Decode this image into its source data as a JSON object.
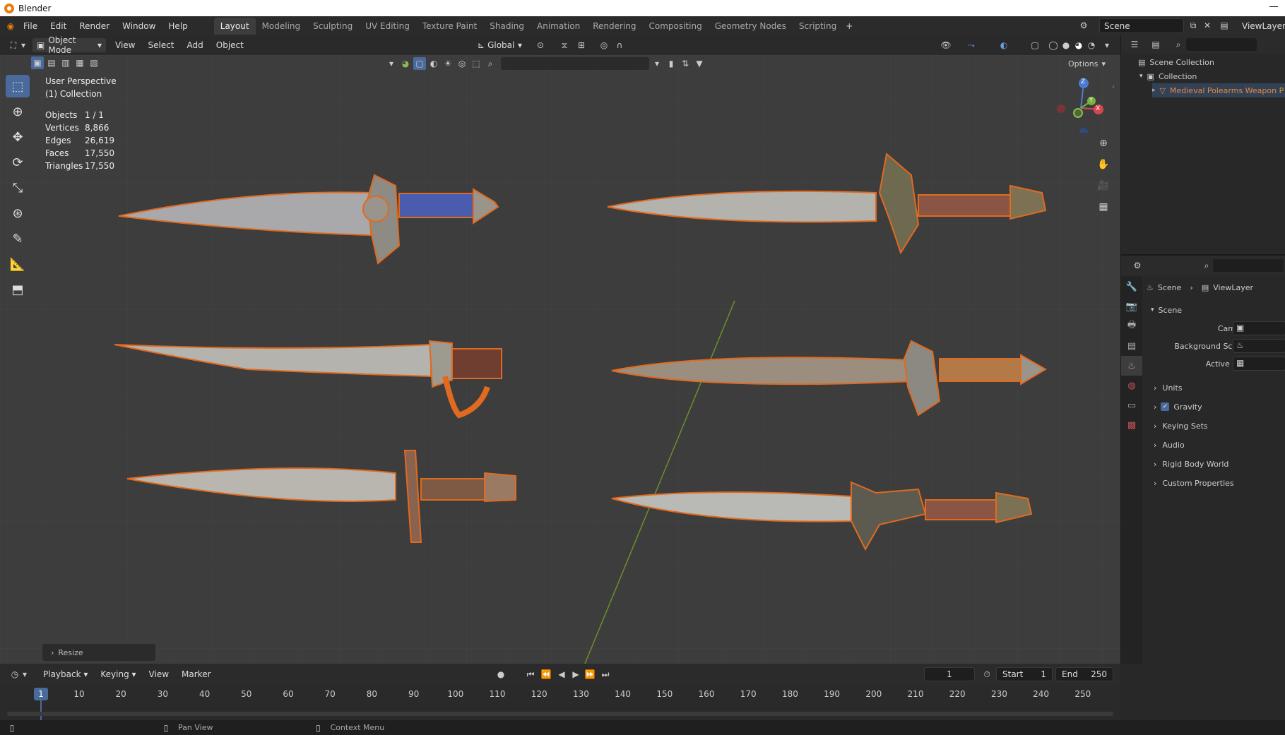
{
  "window_title": "Blender",
  "menu": [
    "File",
    "Edit",
    "Render",
    "Window",
    "Help"
  ],
  "workspaces": [
    "Layout",
    "Modeling",
    "Sculpting",
    "UV Editing",
    "Texture Paint",
    "Shading",
    "Animation",
    "Rendering",
    "Compositing",
    "Geometry Nodes",
    "Scripting"
  ],
  "active_workspace": "Layout",
  "top_right": {
    "scene": "Scene",
    "view_layer": "ViewLayer"
  },
  "viewport_header": {
    "mode": "Object Mode",
    "menus": [
      "View",
      "Select",
      "Add",
      "Object"
    ],
    "transform_orientation": "Global",
    "options": "Options"
  },
  "viewport": {
    "perspective": "User Perspective",
    "collection": "(1) Collection",
    "stats": [
      {
        "label": "Objects",
        "value": "1 / 1"
      },
      {
        "label": "Vertices",
        "value": "8,866"
      },
      {
        "label": "Edges",
        "value": "26,619"
      },
      {
        "label": "Faces",
        "value": "17,550"
      },
      {
        "label": "Triangles",
        "value": "17,550"
      }
    ],
    "resize_panel": "Resize",
    "gizmo_axes": {
      "z": "Z",
      "y": "Y",
      "x": "X"
    }
  },
  "outliner": {
    "root": "Scene Collection",
    "collection": "Collection",
    "object": "Medieval Polearms Weapon P"
  },
  "properties": {
    "breadcrumb_scene": "Scene",
    "breadcrumb_layer": "ViewLayer",
    "section": "Scene",
    "fields": [
      "Camera",
      "Background Scene",
      "Active Clip"
    ],
    "panels": [
      "Units",
      "Gravity",
      "Keying Sets",
      "Audio",
      "Rigid Body World",
      "Custom Properties"
    ],
    "gravity_checked": true
  },
  "timeline": {
    "menus": [
      "Playback",
      "Keying",
      "View",
      "Marker"
    ],
    "current_frame": "1",
    "start_label": "Start",
    "start": "1",
    "end_label": "End",
    "end": "250",
    "ruler": [
      "1",
      "10",
      "20",
      "30",
      "40",
      "50",
      "60",
      "70",
      "80",
      "90",
      "100",
      "110",
      "120",
      "130",
      "140",
      "150",
      "160",
      "170",
      "180",
      "190",
      "200",
      "210",
      "220",
      "230",
      "240",
      "250"
    ]
  },
  "statusbar": {
    "pan": "Pan View",
    "context": "Context Menu"
  },
  "colors": {
    "selection_outline": "#e06a1f",
    "accent": "#4a6a9b",
    "viewport_bg": "#3d3d3d"
  }
}
